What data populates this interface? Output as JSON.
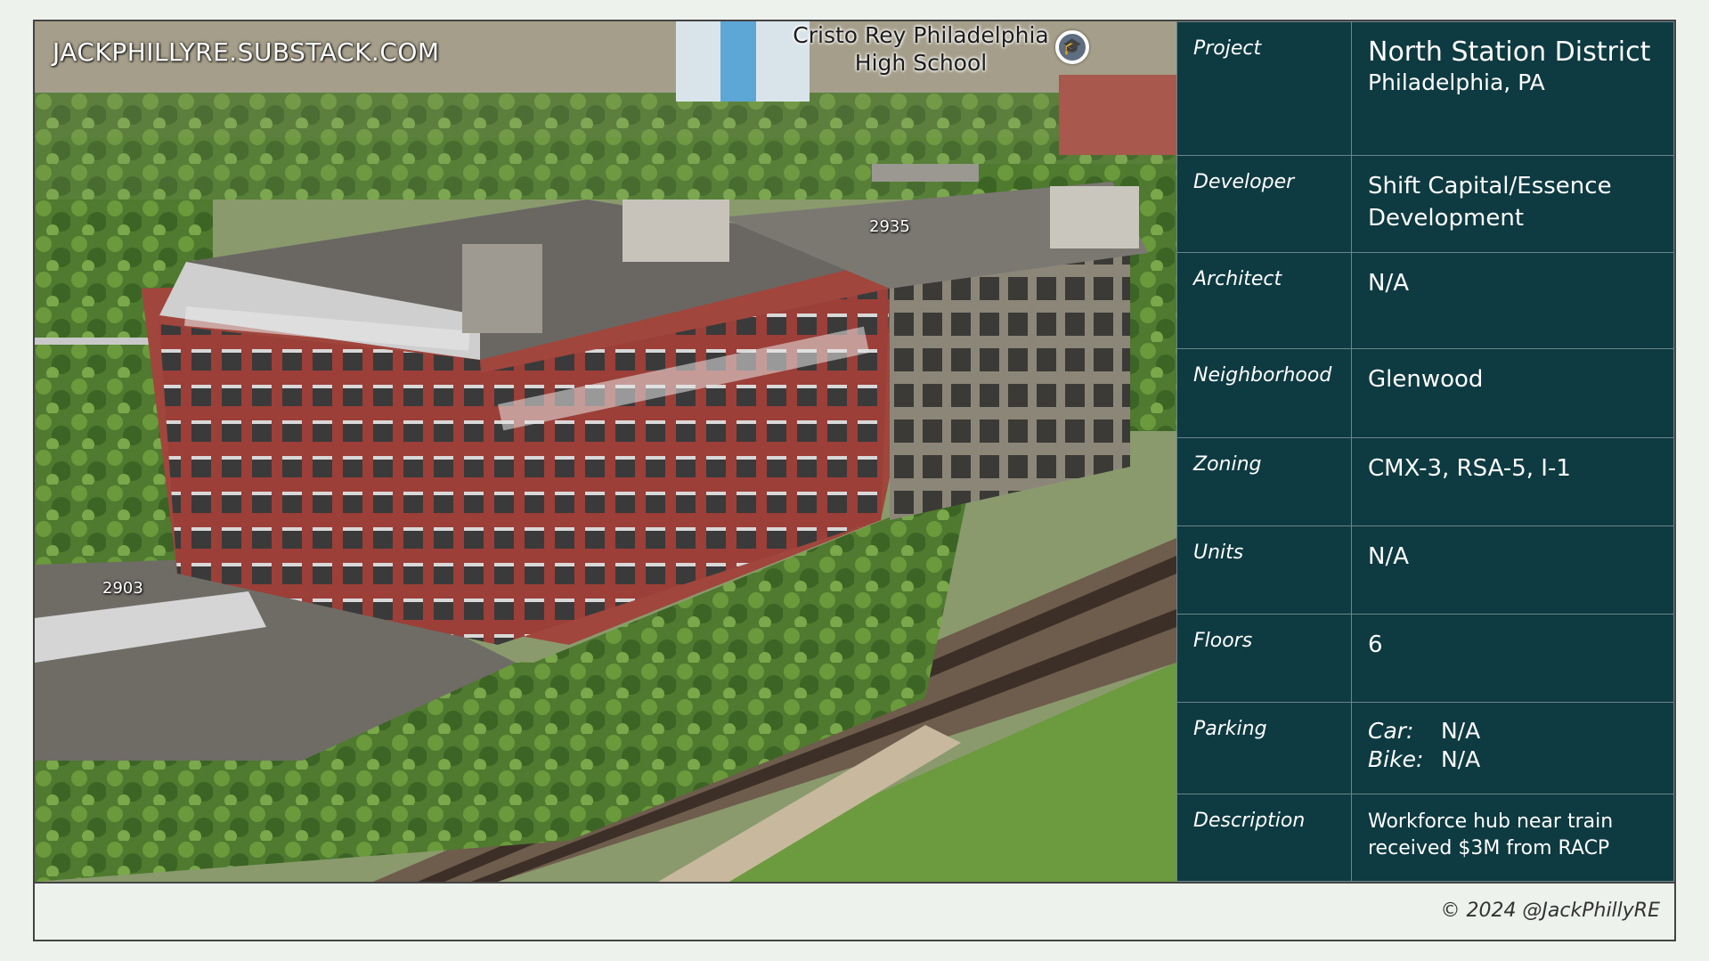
{
  "photo": {
    "watermark": "JACKPHILLYRE.SUBSTACK.COM",
    "poi": {
      "label_line1": "Cristo Rey Philadelphia",
      "label_line2": "High School",
      "icon": "school-icon"
    },
    "address_labels": [
      "2935",
      "2903"
    ]
  },
  "table": {
    "rows": [
      {
        "label": "Project",
        "value": "North Station District",
        "value_sub": "Philadelphia, PA"
      },
      {
        "label": "Developer",
        "value": "Shift Capital/Essence",
        "value_sub": "Development"
      },
      {
        "label": "Architect",
        "value": "N/A"
      },
      {
        "label": "Neighborhood",
        "value": "Glenwood"
      },
      {
        "label": "Zoning",
        "value": "CMX-3, RSA-5, I-1"
      },
      {
        "label": "Units",
        "value": "N/A"
      },
      {
        "label": "Floors",
        "value": "6"
      },
      {
        "label": "Parking",
        "car_label": "Car:",
        "car_value": "N/A",
        "bike_label": "Bike:",
        "bike_value": "N/A"
      },
      {
        "label": "Description",
        "value_line1": "Workforce hub near train",
        "value_line2": "received $3M from RACP"
      }
    ]
  },
  "footer": {
    "copyright": "© 2024 @JackPhillyRE"
  },
  "colors": {
    "table_bg": "#0e3a41",
    "page_bg": "#edf2ec",
    "border": "#6b8589"
  }
}
